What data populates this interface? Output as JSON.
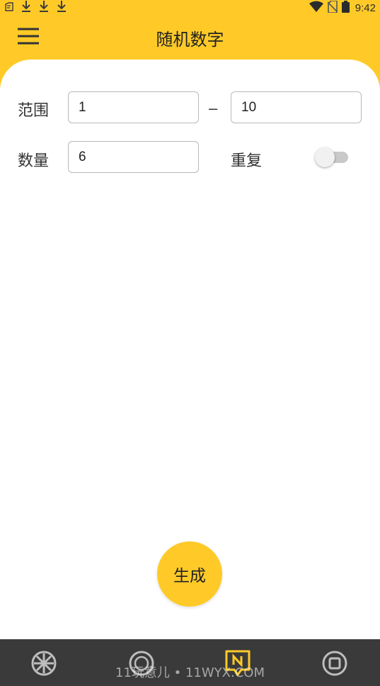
{
  "status_bar": {
    "time": "9:42",
    "left_icons": [
      "notification-icon",
      "download-icon",
      "download-icon",
      "download-icon"
    ],
    "right_icons": [
      "wifi-icon",
      "no-sim-icon",
      "battery-icon"
    ]
  },
  "app_bar": {
    "title": "随机数字",
    "menu_icon": "menu-icon"
  },
  "range": {
    "label": "范围",
    "min_value": "1",
    "separator": "–",
    "max_value": "10"
  },
  "count": {
    "label": "数量",
    "value": "6"
  },
  "repeat": {
    "label": "重复",
    "enabled": false
  },
  "generate": {
    "label": "生成"
  },
  "bottom_nav": {
    "items": [
      {
        "icon": "wheel-icon"
      },
      {
        "icon": "coin-icon"
      },
      {
        "icon": "number-tag-icon",
        "active": true
      },
      {
        "icon": "stop-icon"
      }
    ]
  },
  "watermark": "11玩意儿 • 11WYX.COM",
  "colors": {
    "primary": "#ffca28",
    "nav_background": "#3a3a3a",
    "active_nav": "#ffca28"
  }
}
